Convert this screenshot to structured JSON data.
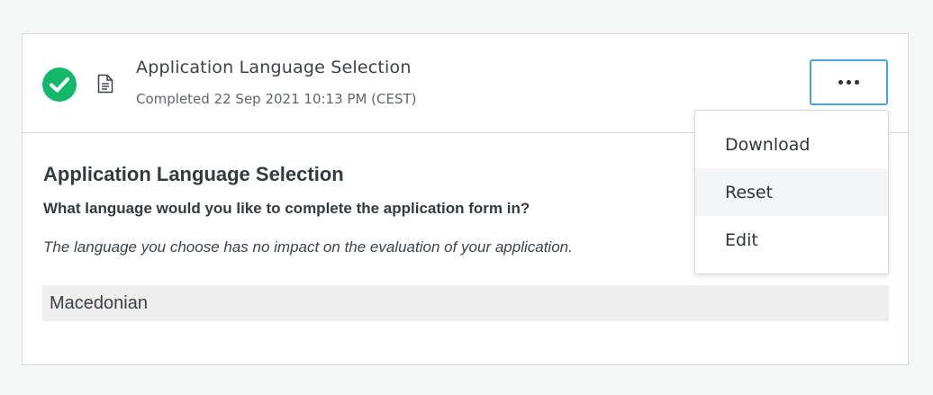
{
  "header": {
    "title": "Application Language Selection",
    "status": "Completed 22 Sep 2021 10:13 PM (CEST)",
    "status_icon": "check-circle-icon",
    "document_icon": "document-icon",
    "more_icon": "more-horizontal-icon"
  },
  "section": {
    "title": "Application Language Selection",
    "question": "What language would you like to complete the application form in?",
    "hint": "The language you choose has no impact on the evaluation of your application.",
    "answer": "Macedonian"
  },
  "menu": {
    "items": [
      {
        "label": "Download"
      },
      {
        "label": "Reset"
      },
      {
        "label": "Edit"
      }
    ]
  },
  "colors": {
    "success": "#14b86a",
    "focus_border": "#4aa3df",
    "answer_background": "#eeeeee"
  }
}
